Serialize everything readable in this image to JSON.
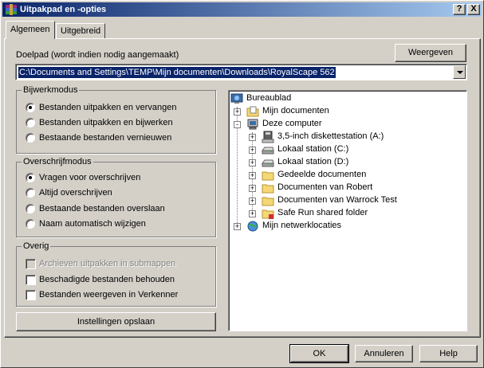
{
  "window": {
    "title": "Uitpakpad en -opties",
    "help_btn": "?",
    "close_btn": "X"
  },
  "tabs": [
    {
      "label": "Algemeen",
      "active": true
    },
    {
      "label": "Uitgebreid",
      "active": false
    }
  ],
  "destination": {
    "label": "Doelpad (wordt indien nodig aangemaakt)",
    "value": "C:\\Documents and Settings\\TEMP\\Mijn documenten\\Downloads\\RoyalScape 562",
    "show_button": "Weergeven"
  },
  "update_mode": {
    "title": "Bijwerkmodus",
    "options": [
      {
        "label": "Bestanden uitpakken en vervangen",
        "selected": true
      },
      {
        "label": "Bestanden uitpakken en bijwerken",
        "selected": false
      },
      {
        "label": "Bestaande bestanden vernieuwen",
        "selected": false
      }
    ]
  },
  "overwrite_mode": {
    "title": "Overschrijfmodus",
    "options": [
      {
        "label": "Vragen voor overschrijven",
        "selected": true
      },
      {
        "label": "Altijd overschrijven",
        "selected": false
      },
      {
        "label": "Bestaande bestanden overslaan",
        "selected": false
      },
      {
        "label": "Naam automatisch wijzigen",
        "selected": false
      }
    ]
  },
  "misc": {
    "title": "Overig",
    "options": [
      {
        "label": "Archieven uitpakken in submappen",
        "checked": false,
        "disabled": true
      },
      {
        "label": "Beschadigde bestanden behouden",
        "checked": false,
        "disabled": false
      },
      {
        "label": "Bestanden weergeven in Verkenner",
        "checked": false,
        "disabled": false
      }
    ]
  },
  "save_settings": "Instellingen opslaan",
  "tree": {
    "desktop": "Bureaublad",
    "my_documents": "Mijn documenten",
    "my_computer": "Deze computer",
    "floppy": "3,5-inch diskettestation (A:)",
    "local_c": "Lokaal station (C:)",
    "local_d": "Lokaal station (D:)",
    "shared_docs": "Gedeelde documenten",
    "docs_robert": "Documenten van Robert",
    "docs_warrock": "Documenten van Warrock Test",
    "safe_run": "Safe Run shared folder",
    "network": "Mijn netwerklocaties"
  },
  "footer": {
    "ok": "OK",
    "cancel": "Annuleren",
    "help": "Help"
  },
  "colors": {
    "title_start": "#0a246a",
    "title_end": "#a6caf0",
    "face": "#d4d0c8",
    "selection": "#0a246a"
  }
}
